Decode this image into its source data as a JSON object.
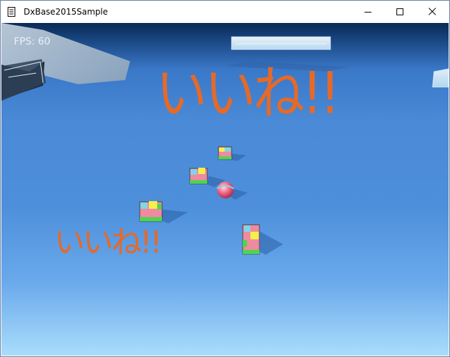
{
  "window": {
    "title": "DxBase2015Sample"
  },
  "controls": {
    "minimize_icon": "minimize-icon",
    "maximize_icon": "maximize-icon",
    "close_icon": "close-icon"
  },
  "hud": {
    "fps": "FPS: 60"
  },
  "scene": {
    "caption_large": "いいね!!",
    "caption_small": "いいね!!",
    "colors": {
      "text_accent": "#e46a2a",
      "ground": "#4d8fdb",
      "sky": "#0c2a54"
    }
  }
}
